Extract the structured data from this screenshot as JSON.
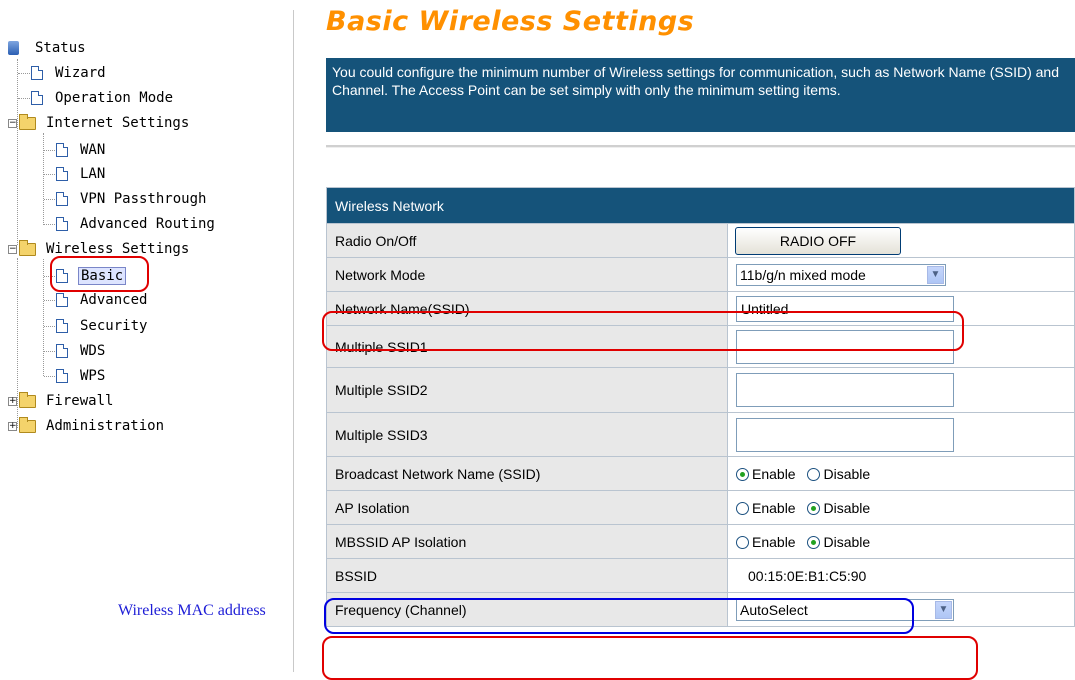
{
  "sidebar": {
    "status": "Status",
    "wizard": "Wizard",
    "operation_mode": "Operation Mode",
    "internet_settings": "Internet Settings",
    "wan": "WAN",
    "lan": "LAN",
    "vpn": "VPN Passthrough",
    "adv_routing": "Advanced Routing",
    "wireless_settings": "Wireless Settings",
    "basic": "Basic",
    "advanced": "Advanced",
    "security": "Security",
    "wds": "WDS",
    "wps": "WPS",
    "firewall": "Firewall",
    "administration": "Administration"
  },
  "page": {
    "title": "Basic Wireless Settings",
    "intro": "You could configure the minimum number of Wireless settings for communication, such as Network Name (SSID) and Channel. The Access Point can be set simply with only the minimum setting items."
  },
  "form": {
    "section_title": "Wireless Network",
    "radio_label": "Radio On/Off",
    "radio_button": "RADIO OFF",
    "network_mode_label": "Network Mode",
    "network_mode_value": "11b/g/n mixed mode",
    "ssid_label": "Network Name(SSID)",
    "ssid_value": "Untitled",
    "mssid1_label": "Multiple SSID1",
    "mssid2_label": "Multiple SSID2",
    "mssid3_label": "Multiple SSID3",
    "broadcast_label": "Broadcast Network Name (SSID)",
    "ap_isolation_label": "AP Isolation",
    "mbssid_label": "MBSSID AP Isolation",
    "enable": "Enable",
    "disable": "Disable",
    "bssid_label": "BSSID",
    "bssid_value": "00:15:0E:B1:C5:90",
    "frequency_label": "Frequency (Channel)",
    "frequency_value": "AutoSelect"
  },
  "annotation": {
    "mac_label": "Wireless MAC address"
  },
  "colors": {
    "title": "#ff9000",
    "header_bg": "#15537a",
    "highlight_red": "#e00000",
    "highlight_blue": "#0000e0"
  }
}
